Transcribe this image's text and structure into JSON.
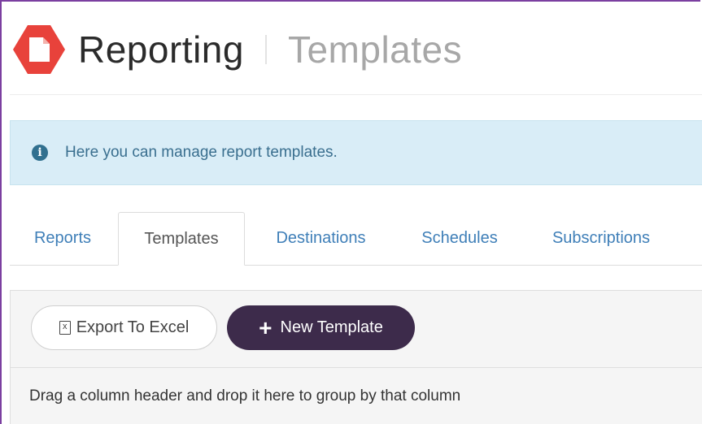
{
  "header": {
    "logo_icon": "document-icon",
    "logo_color": "#e8423b",
    "title": "Reporting",
    "subtitle": "Templates"
  },
  "info": {
    "icon": "info-icon",
    "message": "Here you can manage report templates."
  },
  "tabs": [
    {
      "label": "Reports",
      "active": false
    },
    {
      "label": "Templates",
      "active": true
    },
    {
      "label": "Destinations",
      "active": false
    },
    {
      "label": "Schedules",
      "active": false
    },
    {
      "label": "Subscriptions",
      "active": false
    }
  ],
  "toolbar": {
    "export_label": "Export To Excel",
    "export_icon": "excel-icon",
    "new_label": "New Template",
    "new_icon": "plus-icon",
    "new_color": "#3d2b4b"
  },
  "grid": {
    "group_hint": "Drag a column header and drop it here to group by that column"
  }
}
